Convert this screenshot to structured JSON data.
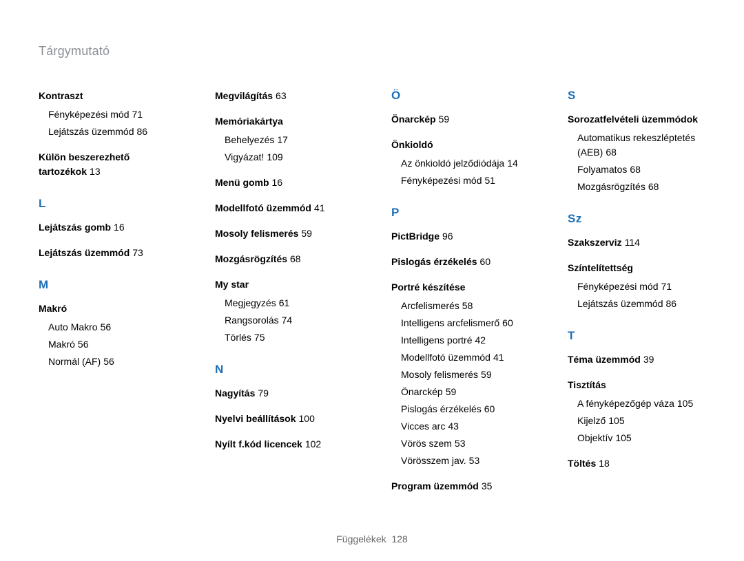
{
  "page_title": "Tárgymutató",
  "footer": {
    "label": "Függelékek",
    "page": "128"
  },
  "col1": {
    "head1": {
      "name": "Kontraszt",
      "page": ""
    },
    "head1_sub1": {
      "name": "Fényképezési mód",
      "page": "71"
    },
    "head1_sub2": {
      "name": "Lejátszás üzemmód",
      "page": "86"
    },
    "head2": {
      "name": "Külön beszerezhető tartozékok",
      "page": "13"
    },
    "letter_L": "L",
    "L1": {
      "name": "Lejátszás gomb",
      "page": "16"
    },
    "L2": {
      "name": "Lejátszás üzemmód",
      "page": "73"
    },
    "letter_M": "M",
    "M1": {
      "name": "Makró",
      "page": ""
    },
    "M1_sub1": {
      "name": "Auto Makro",
      "page": "56"
    },
    "M1_sub2": {
      "name": "Makró",
      "page": "56"
    },
    "M1_sub3": {
      "name": "Normál (AF)",
      "page": "56"
    }
  },
  "col2": {
    "M2": {
      "name": "Megvilágítás",
      "page": "63"
    },
    "M3": {
      "name": "Memóriakártya",
      "page": ""
    },
    "M3_sub1": {
      "name": "Behelyezés",
      "page": "17"
    },
    "M3_sub2": {
      "name": "Vigyázat!",
      "page": "109"
    },
    "M4": {
      "name": "Menü gomb",
      "page": "16"
    },
    "M5": {
      "name": "Modellfotó üzemmód",
      "page": "41"
    },
    "M6": {
      "name": "Mosoly felismerés",
      "page": "59"
    },
    "M7": {
      "name": "Mozgásrögzítés",
      "page": "68"
    },
    "M8": {
      "name": "My star",
      "page": ""
    },
    "M8_sub1": {
      "name": "Megjegyzés",
      "page": "61"
    },
    "M8_sub2": {
      "name": "Rangsorolás",
      "page": "74"
    },
    "M8_sub3": {
      "name": "Törlés",
      "page": "75"
    },
    "letter_N": "N",
    "N1": {
      "name": "Nagyítás",
      "page": "79"
    },
    "N2": {
      "name": "Nyelvi beállítások",
      "page": "100"
    },
    "N3": {
      "name": "Nyílt f.kód licencek",
      "page": "102"
    }
  },
  "col3": {
    "letter_O": "Ö",
    "O1": {
      "name": "Önarckép",
      "page": "59"
    },
    "O2": {
      "name": "Önkioldó",
      "page": ""
    },
    "O2_sub1": {
      "name": "Az önkioldó jelződiódája",
      "page": "14"
    },
    "O2_sub2": {
      "name": "Fényképezési mód",
      "page": "51"
    },
    "letter_P": "P",
    "P1": {
      "name": "PictBridge",
      "page": "96"
    },
    "P2": {
      "name": "Pislogás érzékelés",
      "page": "60"
    },
    "P3": {
      "name": "Portré készítése",
      "page": ""
    },
    "P3_s1": {
      "name": "Arcfelismerés",
      "page": "58"
    },
    "P3_s2": {
      "name": "Intelligens arcfelismerő",
      "page": "60"
    },
    "P3_s3": {
      "name": "Intelligens portré",
      "page": "42"
    },
    "P3_s4": {
      "name": "Modellfotó üzemmód",
      "page": "41"
    },
    "P3_s5": {
      "name": "Mosoly felismerés",
      "page": "59"
    },
    "P3_s6": {
      "name": "Önarckép",
      "page": "59"
    },
    "P3_s7": {
      "name": "Pislogás érzékelés",
      "page": "60"
    },
    "P3_s8": {
      "name": "Vicces arc",
      "page": "43"
    },
    "P3_s9": {
      "name": "Vörös szem",
      "page": "53"
    },
    "P3_s10": {
      "name": "Vörösszem jav.",
      "page": "53"
    },
    "P4": {
      "name": "Program üzemmód",
      "page": "35"
    }
  },
  "col4": {
    "letter_S": "S",
    "S1": {
      "name": "Sorozatfelvételi üzemmódok",
      "page": ""
    },
    "S1_s1": {
      "name": "Automatikus rekeszléptetés (AEB)",
      "page": "68"
    },
    "S1_s2": {
      "name": "Folyamatos",
      "page": "68"
    },
    "S1_s3": {
      "name": "Mozgásrögzítés",
      "page": "68"
    },
    "letter_Sz": "Sz",
    "Sz1": {
      "name": "Szakszerviz",
      "page": "114"
    },
    "Sz2": {
      "name": "Színtelítettség",
      "page": ""
    },
    "Sz2_s1": {
      "name": "Fényképezési mód",
      "page": "71"
    },
    "Sz2_s2": {
      "name": "Lejátszás üzemmód",
      "page": "86"
    },
    "letter_T": "T",
    "T1": {
      "name": "Téma üzemmód",
      "page": "39"
    },
    "T2": {
      "name": "Tisztítás",
      "page": ""
    },
    "T2_s1": {
      "name": "A fényképezőgép váza",
      "page": "105"
    },
    "T2_s2": {
      "name": "Kijelző",
      "page": "105"
    },
    "T2_s3": {
      "name": "Objektív",
      "page": "105"
    },
    "T3": {
      "name": "Töltés",
      "page": "18"
    }
  }
}
